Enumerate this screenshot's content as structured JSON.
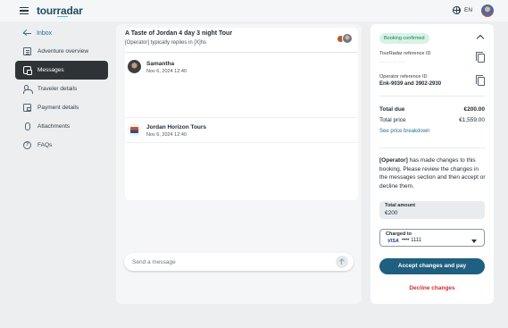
{
  "header": {
    "logo_text": "tourradar",
    "language": "EN"
  },
  "sidebar": {
    "back_label": "Inbox",
    "items": [
      {
        "label": "Adventure overview",
        "icon": "document-icon"
      },
      {
        "label": "Messages",
        "icon": "messages-icon",
        "active": true
      },
      {
        "label": "Traveler details",
        "icon": "people-icon"
      },
      {
        "label": "Payment details",
        "icon": "wallet-icon"
      },
      {
        "label": "Attachments",
        "icon": "paperclip-icon"
      },
      {
        "label": "FAQs",
        "icon": "question-icon"
      }
    ]
  },
  "conversation": {
    "title": "A Taste of Jordan 4 day 3 night Tour",
    "reply_note": "[Operator] typically replies in [X]hs",
    "messages": [
      {
        "sender": "Samantha",
        "time": "Nov 6, 2024 12:40"
      },
      {
        "sender": "Jordan Horizon Tours",
        "time": "Nov 6, 2024 12:40"
      }
    ],
    "composer_placeholder": "Send a message"
  },
  "booking": {
    "status": "Booking confirmed",
    "tourradar_ref_label": "TourRadar reference ID",
    "tourradar_ref_value": "------ ---",
    "operator_ref_label": "Operator reference ID",
    "operator_ref_value": "Enk-9039 and 3902-2930",
    "total_due_label": "Total due",
    "total_due_value": "€200.00",
    "total_price_label": "Total price",
    "total_price_value": "€1,559.00",
    "price_breakdown_link": "See price breakdown",
    "notice_operator": "[Operator]",
    "notice_text": " has made changes to this booking. Please review the changes in the messages section and then accept or decline them.",
    "total_amount_label": "Total amount",
    "total_amount_value": "€200",
    "charged_to_label": "Charged to",
    "card_brand": "VISA",
    "card_number": "•••• 1111",
    "accept_button": "Accept changes and pay",
    "decline_button": "Decline changes"
  },
  "colors": {
    "accent": "#1f5f80",
    "link": "#2b6f92",
    "decline": "#d0302d",
    "badge_bg": "#d7f2e6",
    "badge_text": "#1c7a4f",
    "active_nav_bg": "#2e3336"
  }
}
